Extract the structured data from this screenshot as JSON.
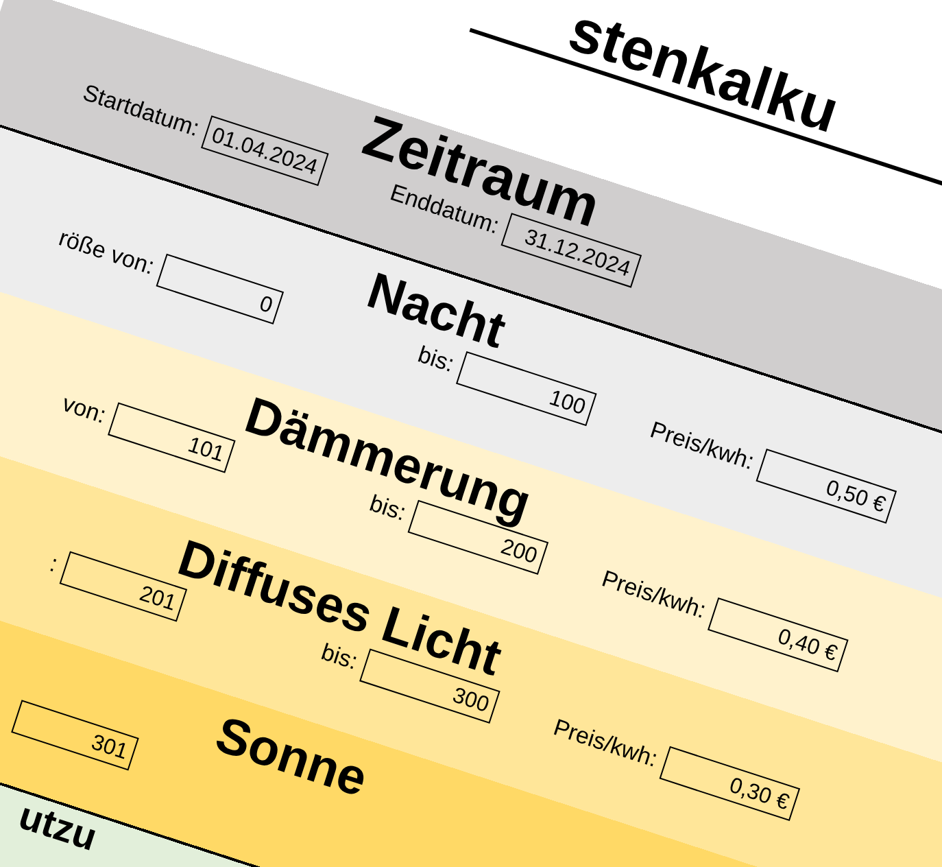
{
  "title": "stenkalku",
  "period": {
    "heading": "Zeitraum",
    "color": "#d0cece",
    "start_label": "Startdatum:",
    "start_date": "01.04.2024",
    "end_label": "Enddatum:",
    "end_date": "31.12.2024"
  },
  "tiers": [
    {
      "name": "Nacht",
      "color": "#ededed",
      "from_label": "röße von:",
      "from_value": "0",
      "to_label": "bis:",
      "to_value": "100",
      "price_label": "Preis/kwh:",
      "price_value": "0,50 €"
    },
    {
      "name": "Dämmerung",
      "color": "#fff2cc",
      "from_label": "von:",
      "from_value": "101",
      "to_label": "bis:",
      "to_value": "200",
      "price_label": "Preis/kwh:",
      "price_value": "0,40 €"
    },
    {
      "name": "Diffuses Licht",
      "color": "#ffe699",
      "from_label": ":",
      "from_value": "201",
      "to_label": "bis:",
      "to_value": "300",
      "price_label": "Preis/kwh:",
      "price_value": "0,30 €"
    },
    {
      "name": "Sonne",
      "color": "#ffd966",
      "from_value": "301"
    }
  ],
  "next_section": {
    "heading": "utzu",
    "color": "#e2efda"
  }
}
